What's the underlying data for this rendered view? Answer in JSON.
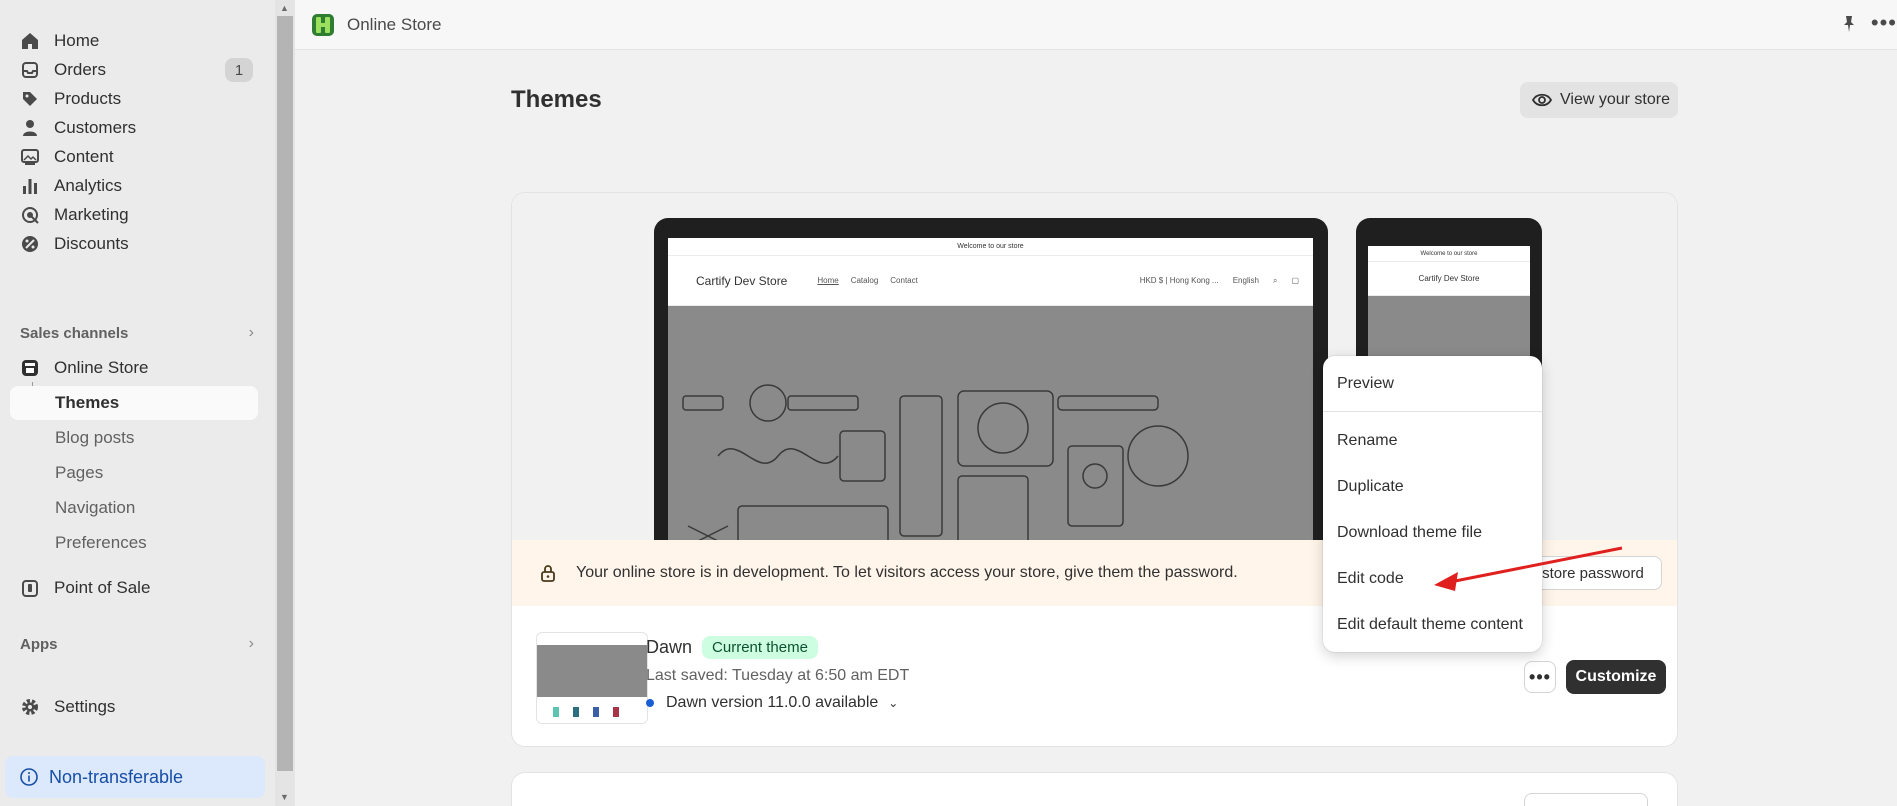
{
  "sidebar": {
    "items": [
      {
        "label": "Home"
      },
      {
        "label": "Orders",
        "badge": "1"
      },
      {
        "label": "Products"
      },
      {
        "label": "Customers"
      },
      {
        "label": "Content"
      },
      {
        "label": "Analytics"
      },
      {
        "label": "Marketing"
      },
      {
        "label": "Discounts"
      }
    ],
    "sales_channels": "Sales channels",
    "online_store": "Online Store",
    "sub_items": [
      "Themes",
      "Blog posts",
      "Pages",
      "Navigation",
      "Preferences"
    ],
    "point_of_sale": "Point of Sale",
    "apps": "Apps",
    "settings": "Settings",
    "non_transferable": "Non-transferable"
  },
  "topbar": {
    "title": "Online Store"
  },
  "page": {
    "title": "Themes",
    "view_store": "View your store"
  },
  "preview": {
    "announcement": "Welcome to our store",
    "store_name": "Cartify Dev Store",
    "links": [
      "Home",
      "Catalog",
      "Contact"
    ],
    "currency": "HKD $ | Hong Kong ...",
    "language": "English"
  },
  "banner": {
    "text": "Your online store is in development. To let visitors access your store, give them the password.",
    "button": "store password"
  },
  "theme": {
    "name": "Dawn",
    "badge": "Current theme",
    "saved": "Last saved: Tuesday at 6:50 am EDT",
    "version": "Dawn version 11.0.0 available",
    "customize": "Customize"
  },
  "menu": {
    "items": [
      "Preview",
      "Rename",
      "Duplicate",
      "Download theme file",
      "Edit code",
      "Edit default theme content"
    ]
  },
  "colors": {
    "accent_dark": "#303030",
    "badge_green": "#cdfee1",
    "banner_bg": "#fff5ea",
    "annotation_red": "#e0201f"
  }
}
